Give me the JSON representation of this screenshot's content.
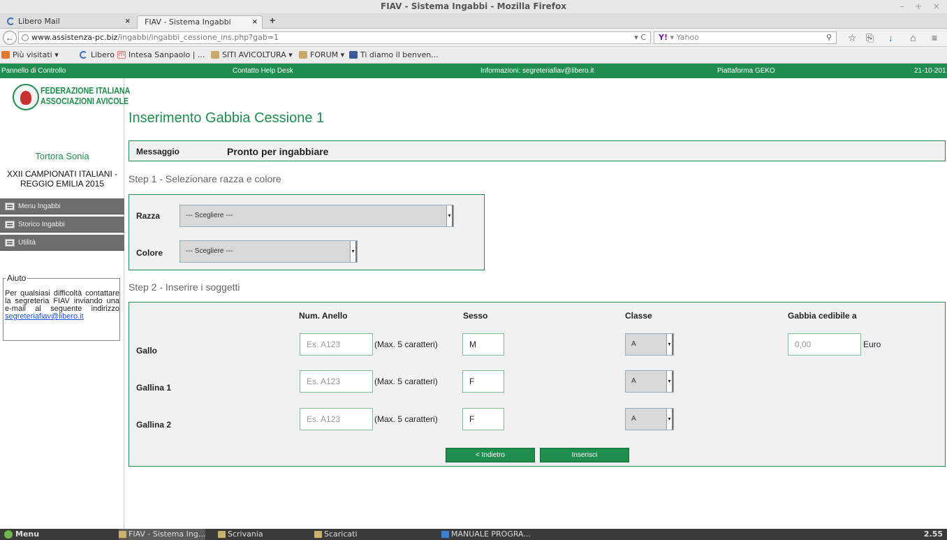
{
  "window": {
    "title": "FIAV - Sistema Ingabbi - Mozilla Firefox",
    "controls": "– + ×"
  },
  "tabs": [
    {
      "label": "Libero Mail",
      "close": "×"
    },
    {
      "label": "FIAV - Sistema Ingabbi",
      "close": "×"
    }
  ],
  "new_tab": "+",
  "navbar": {
    "back": "←",
    "url_host": "www.assistenza-pc.biz",
    "url_path": "/ingabbi/ingabbi_cessione_ins.php?gab=1",
    "reload": "▾ C",
    "search_engine": "Y!",
    "search_placeholder": "▾ Yahoo",
    "search_icon": "⚲",
    "icons": [
      "☆",
      "⎘",
      "↓",
      "⌂",
      "≡"
    ]
  },
  "bookmarks": [
    "Più visitati ▾",
    "Libero",
    "Intesa Sanpaolo | ...",
    "SITI AVICOLTURA ▾",
    "FORUM ▾",
    "Ti diamo il benven..."
  ],
  "greenbar": {
    "pannello": "Pannello di Controllo",
    "helpdesk": "Contatto Help Desk",
    "info": "Informazioni: segreteriafiav@libero.it",
    "piattaforma": "Piattaforma GEKO",
    "date": "21-10-201"
  },
  "sidebar": {
    "logo_line1": "FEDERAZIONE ITALIANA",
    "logo_line2": "ASSOCIAZIONI AVICOLE",
    "user": "Tortora Sonia",
    "event_line1": "XXII CAMPIONATI ITALIANI -",
    "event_line2": "REGGIO EMILIA 2015",
    "menu": [
      "Menu Ingabbi",
      "Storico Ingabbi",
      "Utilità"
    ],
    "help_title": "Aiuto",
    "help_text": "Per qualsiasi difficoltà contattare la segreteria FIAV inviando una e-mail al seguente indirizzo",
    "help_email": "segreteriafiav@libero.it"
  },
  "main": {
    "title": "Inserimento Gabbia Cessione 1",
    "message_label": "Messaggio",
    "message_value": "Pronto per ingabbiare",
    "step1_title": "Step 1 - Selezionare razza e colore",
    "razza_label": "Razza",
    "razza_value": "--- Scegliere ---",
    "colore_label": "Colore",
    "colore_value": "--- Scegliere ---",
    "step2_title": "Step 2 - Inserire i soggetti",
    "columns": [
      "Num. Anello",
      "Sesso",
      "Classe",
      "Gabbia cedibile a"
    ],
    "ring_placeholder": "Es. A123",
    "ring_note": "(Max. 5 caratteri)",
    "rows": [
      {
        "label": "Gallo",
        "sesso": "M",
        "classe": "A"
      },
      {
        "label": "Gallina 1",
        "sesso": "F",
        "classe": "A"
      },
      {
        "label": "Gallina 2",
        "sesso": "F",
        "classe": "A"
      }
    ],
    "price_placeholder": "0,00",
    "price_unit": "Euro",
    "back_button": "< Indietro",
    "submit_button": "Inserisci",
    "select_arrow": "▾"
  },
  "taskbar": {
    "menu": "Menu",
    "items": [
      "FIAV - Sistema Ing...",
      "Scrivania",
      "Scaricati",
      "MANUALE PROGRA..."
    ],
    "clock": "2.55"
  }
}
